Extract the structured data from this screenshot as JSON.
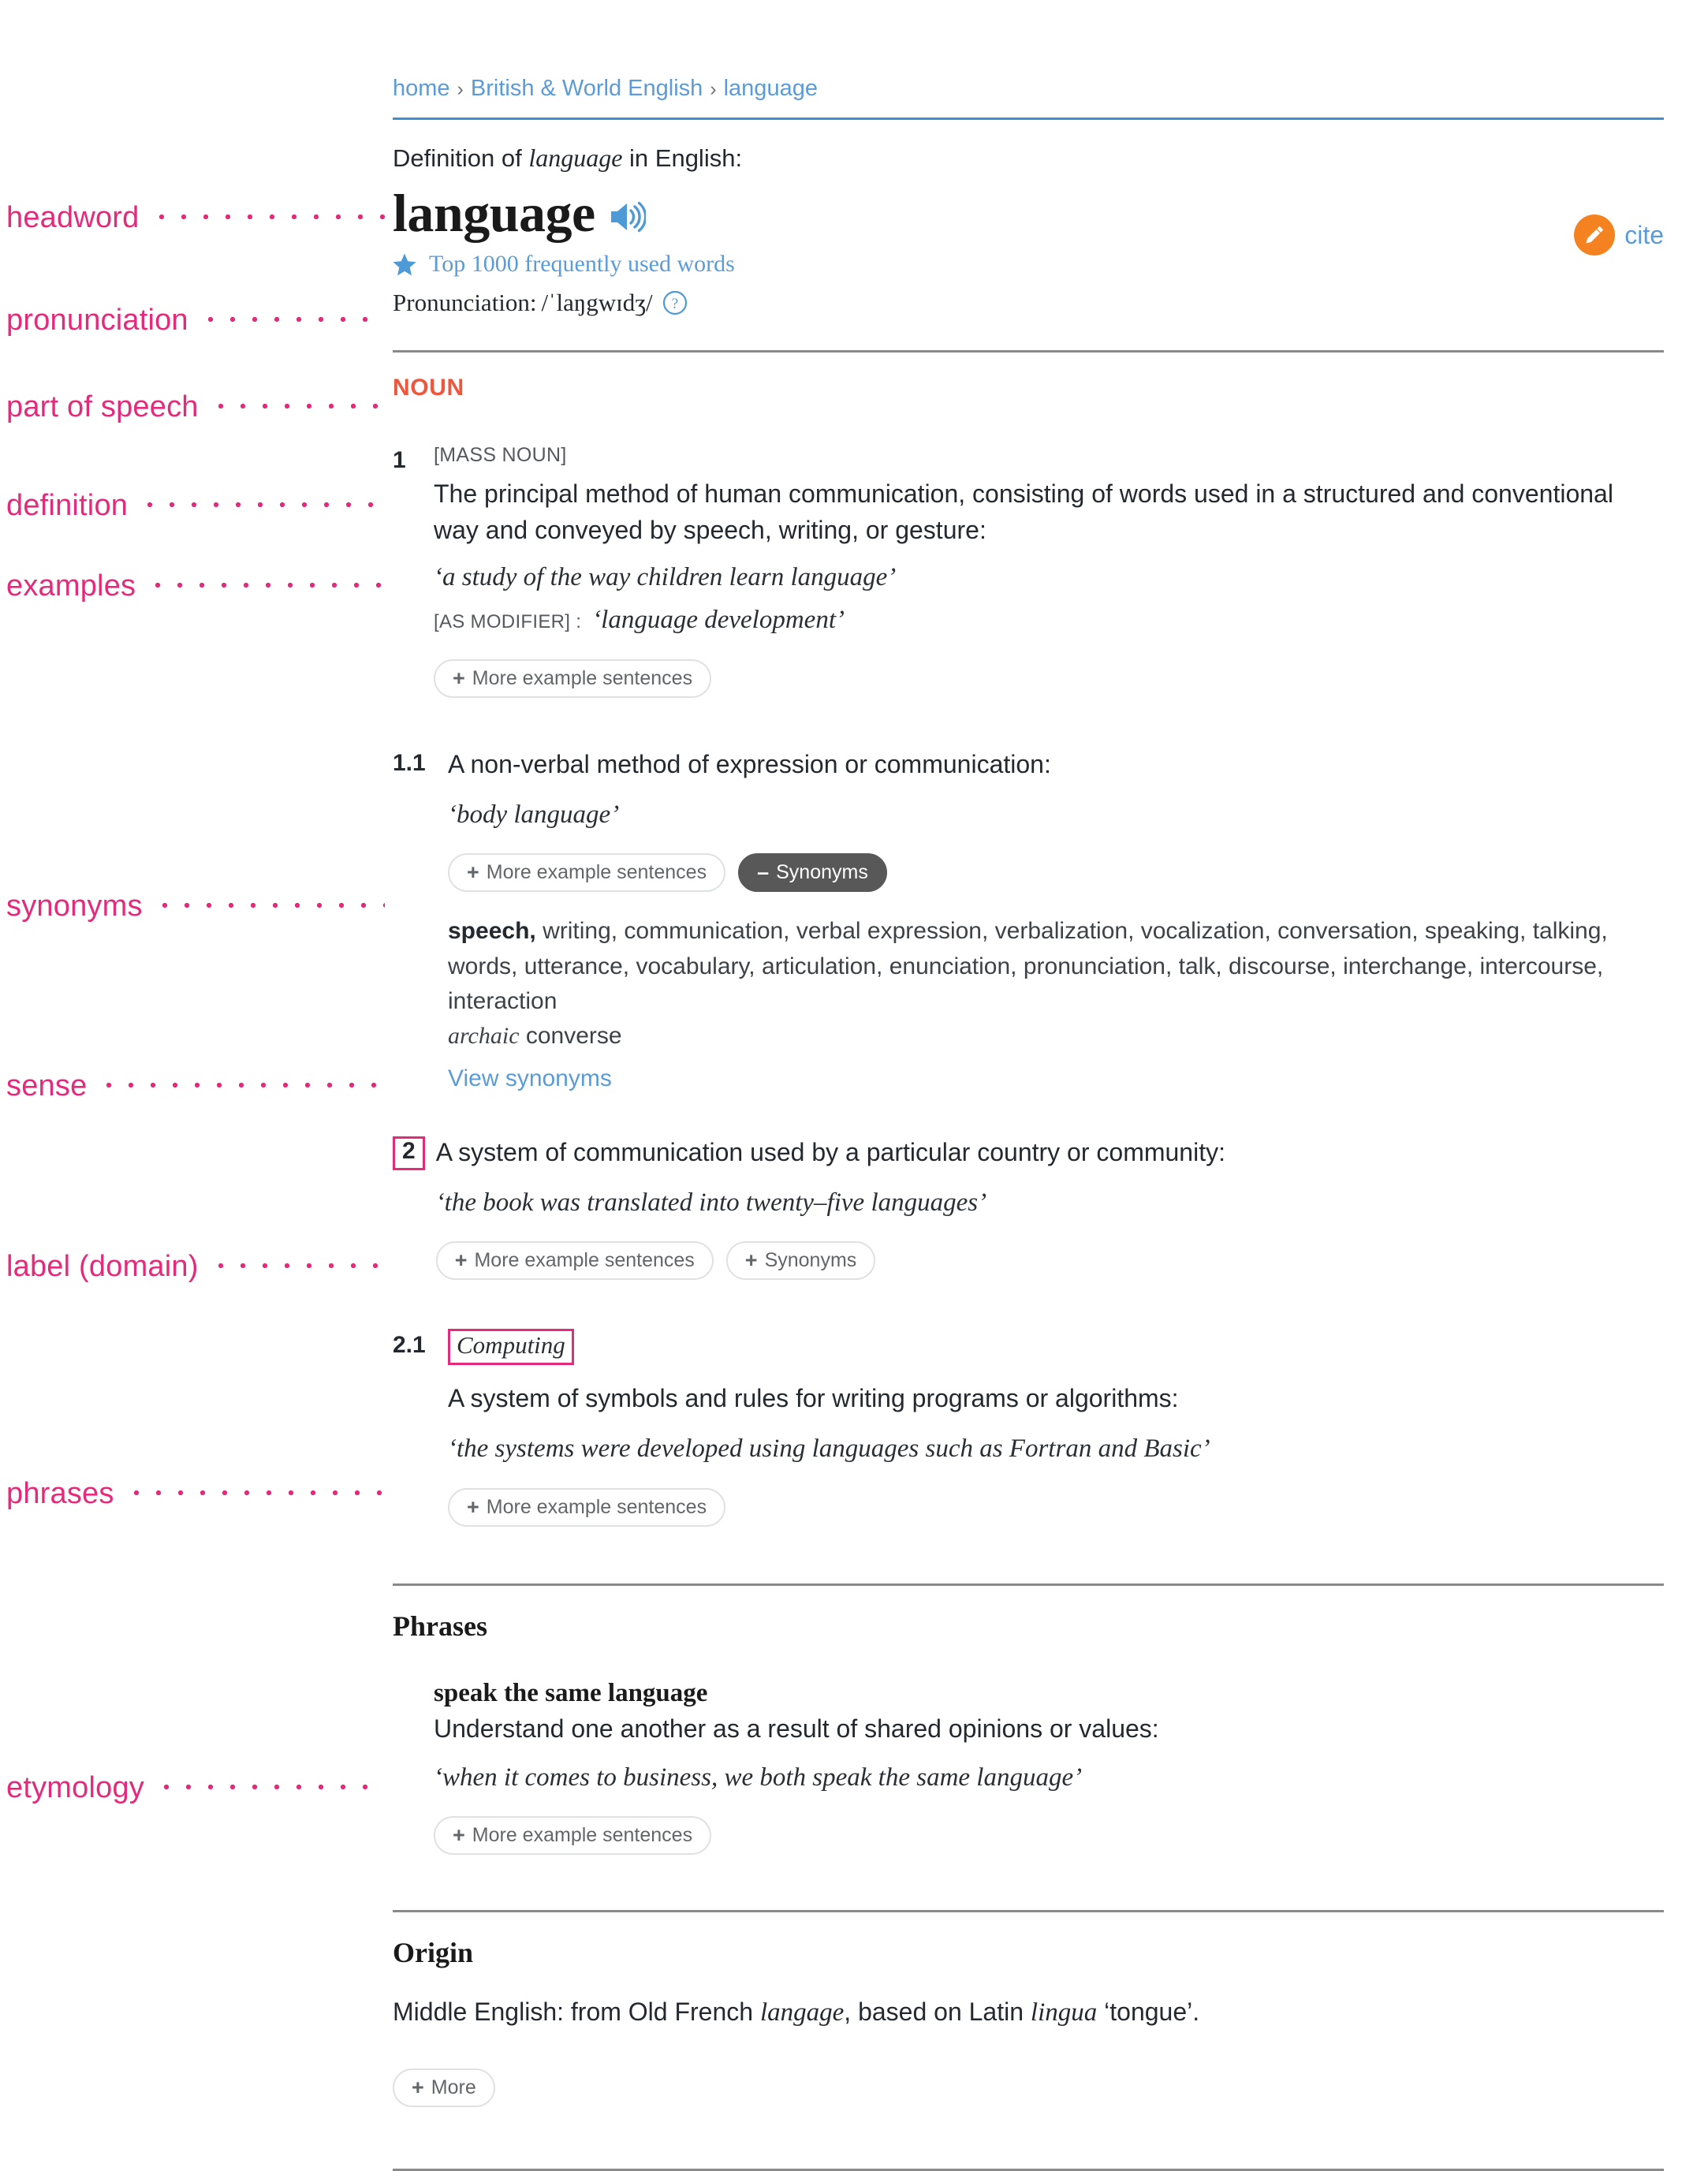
{
  "breadcrumb": {
    "items": [
      "home",
      "British & World English",
      "language"
    ],
    "separator": "›"
  },
  "header": {
    "definition_of_prefix": "Definition of ",
    "definition_of_word": "language",
    "definition_of_suffix": " in English:",
    "headword": "language",
    "speaker_icon": "speaker-icon",
    "frequency_badge": "Top 1000 frequently used words",
    "star_icon": "star-icon",
    "pronunciation_label": "Pronunciation:",
    "pronunciation_ipa": "/ˈlaŋgwɪdʒ/",
    "help_icon": "question-mark-icon",
    "cite_label": "cite",
    "cite_icon": "pencil-icon"
  },
  "annotations": {
    "headword": "headword",
    "pronunciation": "pronunciation",
    "part_of_speech": "part of speech",
    "definition": "definition",
    "examples": "examples",
    "synonyms": "synonyms",
    "sense": "sense",
    "label_domain": "label (domain)",
    "phrases": "phrases",
    "etymology": "etymology"
  },
  "entry": {
    "part_of_speech": "NOUN",
    "senses": [
      {
        "number": "1",
        "grammar_note": "[MASS NOUN]",
        "definition": "The principal method of human communication, consisting of words used in a structured and conventional way and conveyed by speech, writing, or gesture:",
        "examples": [
          "‘a study of the way children learn language’"
        ],
        "modifier_tag": "[AS MODIFIER] :",
        "modifier_example": "‘language development’",
        "more_examples_button": "More example sentences"
      },
      {
        "number": "1.1",
        "definition": "A non-verbal method of expression or communication:",
        "examples": [
          "‘body language’"
        ],
        "more_examples_button": "More example sentences",
        "synonyms_button": "Synonyms",
        "synonyms_button_sign": "–",
        "synonyms_lead": "speech,",
        "synonyms_list": " writing, communication, verbal expression, verbalization, vocalization, conversation, speaking, talking, words, utterance, vocabulary, articulation, enunciation, pronunciation, talk, discourse, interchange, intercourse, interaction",
        "synonyms_archaic_label": "archaic",
        "synonyms_archaic_word": " converse",
        "view_synonyms_link": "View synonyms"
      },
      {
        "number": "2",
        "definition": "A system of communication used by a particular country or community:",
        "examples": [
          "‘the book was translated into twenty–five languages’"
        ],
        "more_examples_button": "More example sentences",
        "synonyms_button": "Synonyms"
      },
      {
        "number": "2.1",
        "domain_label": "Computing",
        "definition": "A system of symbols and rules for writing programs or algorithms:",
        "examples": [
          "‘the systems were developed using languages such as Fortran and Basic’"
        ],
        "more_examples_button": "More example sentences"
      }
    ]
  },
  "phrases_section": {
    "heading": "Phrases",
    "items": [
      {
        "phrase": "speak the same language",
        "definition": "Understand one another as a result of shared opinions or values:",
        "example": "‘when it comes to business, we both speak the same language’",
        "more_examples_button": "More example sentences"
      }
    ]
  },
  "origin_section": {
    "heading": "Origin",
    "text_1": "Middle English: from Old French ",
    "italic_1": "langage",
    "text_2": ", based on Latin ",
    "italic_2": "lingua",
    "text_3": " ‘tongue’.",
    "more_button": "More"
  },
  "buttons": {
    "plus_sign": "+",
    "minus_sign": "–"
  },
  "colors": {
    "annotation_pink": "#e62a7b",
    "link_blue": "#5a9bd8",
    "pos_orange": "#f0563c",
    "cite_orange": "#f58220",
    "rule_gray": "#8a8a8a",
    "rule_blue": "#3f8fd0",
    "dark_pill": "#585858"
  }
}
